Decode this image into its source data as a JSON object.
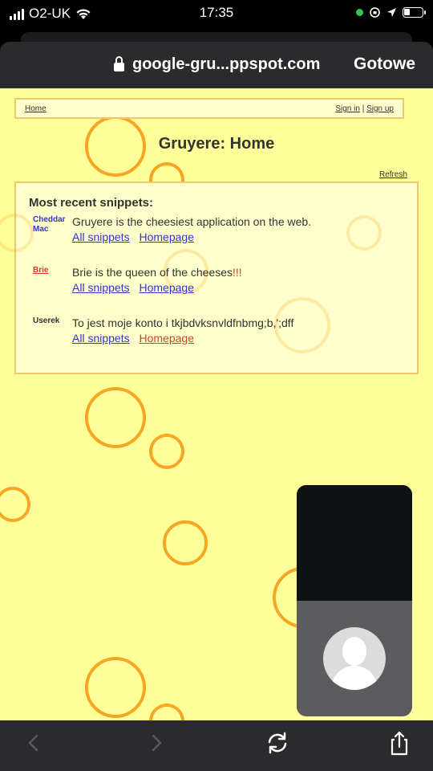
{
  "status_bar": {
    "carrier": "O2-UK",
    "time": "17:35"
  },
  "browser": {
    "url": "google-gru...ppspot.com",
    "done_label": "Gotowe"
  },
  "page": {
    "background_color": "#ffff99",
    "accent_color": "#f5a623",
    "nav": {
      "home_label": "Home",
      "sign_in_label": "Sign in",
      "separator": "|",
      "sign_up_label": "Sign up"
    },
    "title": "Gruyere: Home",
    "refresh_label": "Refresh",
    "snippets_heading": "Most recent snippets:",
    "snippets": [
      {
        "user": "Cheddar Mac",
        "user_color": "#3535c8",
        "text": "Gruyere is the cheesiest application on the web.",
        "text_emph": "",
        "all_label": "All snippets",
        "home_label": "Homepage"
      },
      {
        "user": "Brie",
        "user_color": "#e0342b",
        "text": "Brie is the queen of the cheeses",
        "text_emph": "!!!",
        "all_label": "All snippets",
        "home_label": "Homepage"
      },
      {
        "user": "Userek",
        "user_color": "#333333",
        "text": "To jest moje konto i tkjbdvksnvldfnbmg;b,';dff",
        "text_emph": "",
        "all_label": "All snippets",
        "home_label": "Homepage"
      }
    ]
  },
  "toolbar": {
    "icons": [
      "back-icon",
      "forward-icon",
      "refresh-icon",
      "share-icon"
    ]
  },
  "pip": {
    "icons": [
      "avatar-icon"
    ]
  }
}
